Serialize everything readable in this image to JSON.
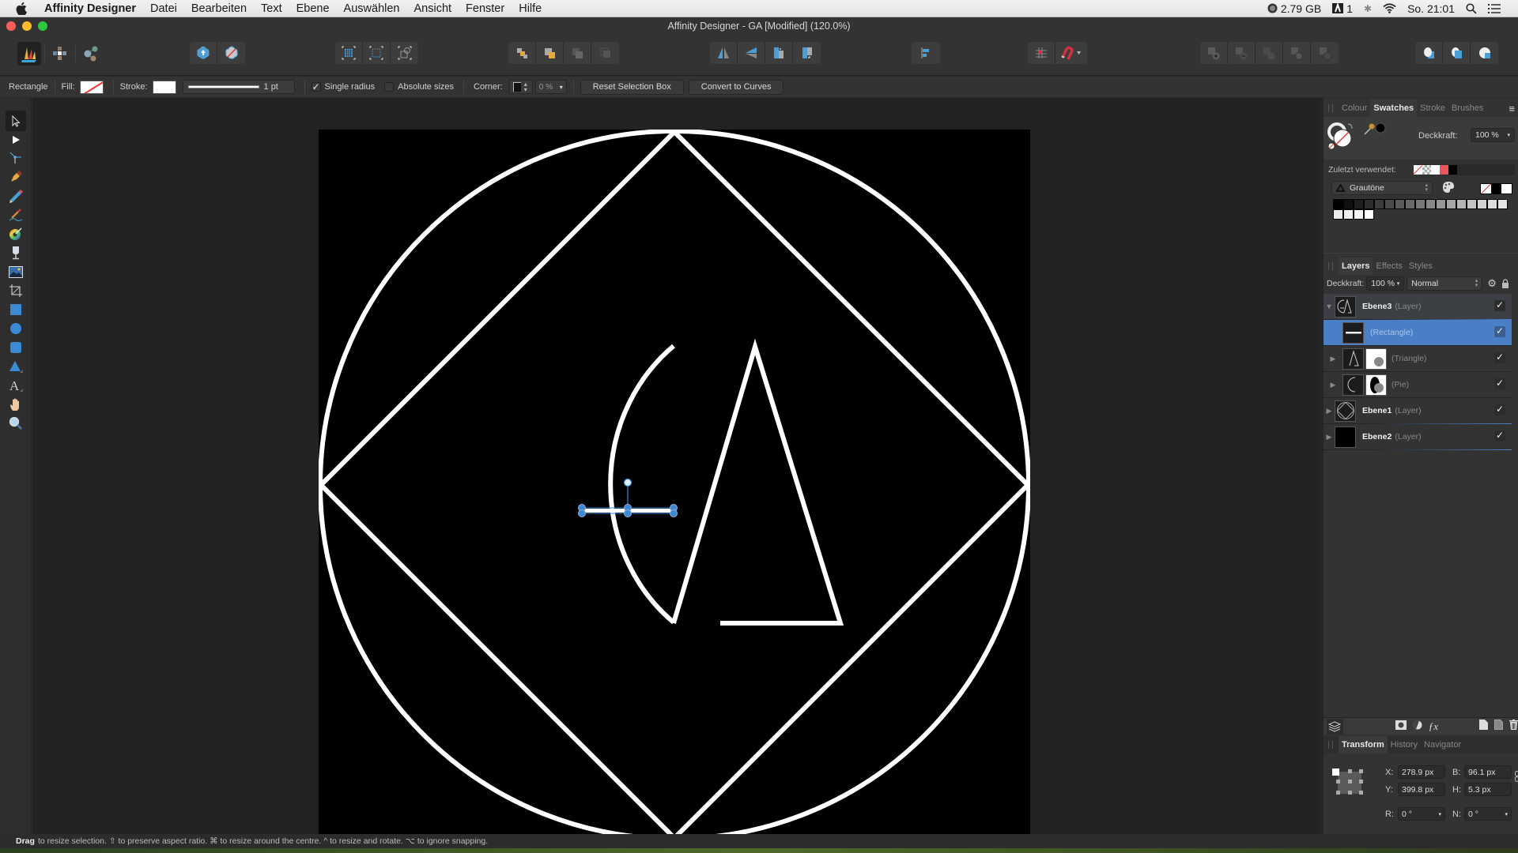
{
  "menubar": {
    "app_name": "Affinity Designer",
    "items": [
      "Datei",
      "Bearbeiten",
      "Text",
      "Ebene",
      "Auswählen",
      "Ansicht",
      "Fenster",
      "Hilfe"
    ],
    "status": {
      "memory": "2.79 GB",
      "adobe_count": "1",
      "clock": "So. 21:01"
    }
  },
  "window": {
    "title": "Affinity Designer - GA [Modified] (120.0%)"
  },
  "toolbar": {
    "personas": [
      "designer-persona",
      "pixel-persona",
      "export-persona"
    ],
    "groups": {
      "quick_actions": [
        "insert-behind",
        "no-fill-toggle"
      ],
      "selection_box": [
        "selection-box-grid",
        "selection-box-dotted",
        "transform-objects"
      ],
      "arrange": [
        "move-to-back",
        "move-back-one",
        "move-forward-one",
        "move-to-front"
      ],
      "flip_rotate": [
        "flip-horizontal",
        "flip-vertical",
        "rotate-counterclockwise",
        "rotate-clockwise"
      ],
      "align": [
        "align-left"
      ],
      "snapping": [
        "snapping-grid",
        "snapping-magnet"
      ],
      "boolean": [
        "add",
        "subtract",
        "intersect",
        "xor",
        "divide"
      ],
      "insert": [
        "insert-inside",
        "insert-top",
        "insert-behind-selection"
      ]
    }
  },
  "context": {
    "shape_type": "Rectangle",
    "fill_label": "Fill:",
    "stroke_label": "Stroke:",
    "stroke_width": "1 pt",
    "single_radius_label": "Single radius",
    "single_radius_checked": true,
    "absolute_sizes_label": "Absolute sizes",
    "absolute_sizes_checked": false,
    "corner_label": "Corner:",
    "corner_value": "0 %",
    "reset_button": "Reset Selection Box",
    "convert_button": "Convert to Curves"
  },
  "tools": [
    "move-tool",
    "node-tool",
    "corner-tool",
    "pen-tool",
    "pencil-tool",
    "vector-brush-tool",
    "fill-tool",
    "transparency-tool",
    "place-image-tool",
    "artboard-tool",
    "rectangle-tool",
    "ellipse-tool",
    "rounded-rectangle-tool",
    "triangle-tool",
    "artistic-text-tool",
    "view-tool",
    "zoom-tool"
  ],
  "swatches_panel": {
    "tabs": [
      "Colour",
      "Swatches",
      "Stroke",
      "Brushes"
    ],
    "active_tab": "Swatches",
    "opacity_label": "Deckkraft:",
    "opacity_value": "100 %",
    "recent_label": "Zuletzt verwendet:",
    "recent_colors": [
      "none",
      "transparent",
      "#ffffff",
      "#e8555a",
      "#000000"
    ],
    "palette_name": "Grautöne",
    "palette_colors": [
      "#000000",
      "#0f0f0f",
      "#1e1e1e",
      "#2d2d2d",
      "#3c3c3c",
      "#4b4b4b",
      "#5a5a5a",
      "#696969",
      "#787878",
      "#878787",
      "#969696",
      "#a5a5a5",
      "#b4b4b4",
      "#c3c3c3",
      "#d2d2d2",
      "#dcdcdc",
      "#e6e6e6",
      "#ebebeb",
      "#f0f0f0",
      "#f7f7f7",
      "#ffffff"
    ]
  },
  "layers_panel": {
    "tabs": [
      "Layers",
      "Effects",
      "Styles"
    ],
    "active_tab": "Layers",
    "opacity_label": "Deckkraft:",
    "opacity_value": "100 %",
    "blend_mode": "Normal",
    "layers": [
      {
        "name": "Ebene3",
        "type": "(Layer)",
        "expanded": true,
        "visible": true
      },
      {
        "name": "",
        "type": "(Rectangle)",
        "selected": true,
        "visible": true
      },
      {
        "name": "",
        "type": "(Triangle)",
        "visible": true
      },
      {
        "name": "",
        "type": "(Pie)",
        "visible": true
      },
      {
        "name": "Ebene1",
        "type": "(Layer)",
        "visible": true
      },
      {
        "name": "Ebene2",
        "type": "(Layer)",
        "visible": true
      }
    ]
  },
  "transform_panel": {
    "tabs": [
      "Transform",
      "History",
      "Navigator"
    ],
    "active_tab": "Transform",
    "x_label": "X:",
    "x_value": "278.9 px",
    "y_label": "Y:",
    "y_value": "399.8 px",
    "w_label": "B:",
    "w_value": "96.1 px",
    "h_label": "H:",
    "h_value": "5.3 px",
    "r_label": "R:",
    "r_value": "0 °",
    "s_label": "N:",
    "s_value": "0 °"
  },
  "statusbar": {
    "bold": "Drag",
    "text": "to resize selection. ⇧ to preserve aspect ratio. ⌘ to resize around the centre. ^ to resize and rotate. ⌥ to ignore snapping."
  }
}
